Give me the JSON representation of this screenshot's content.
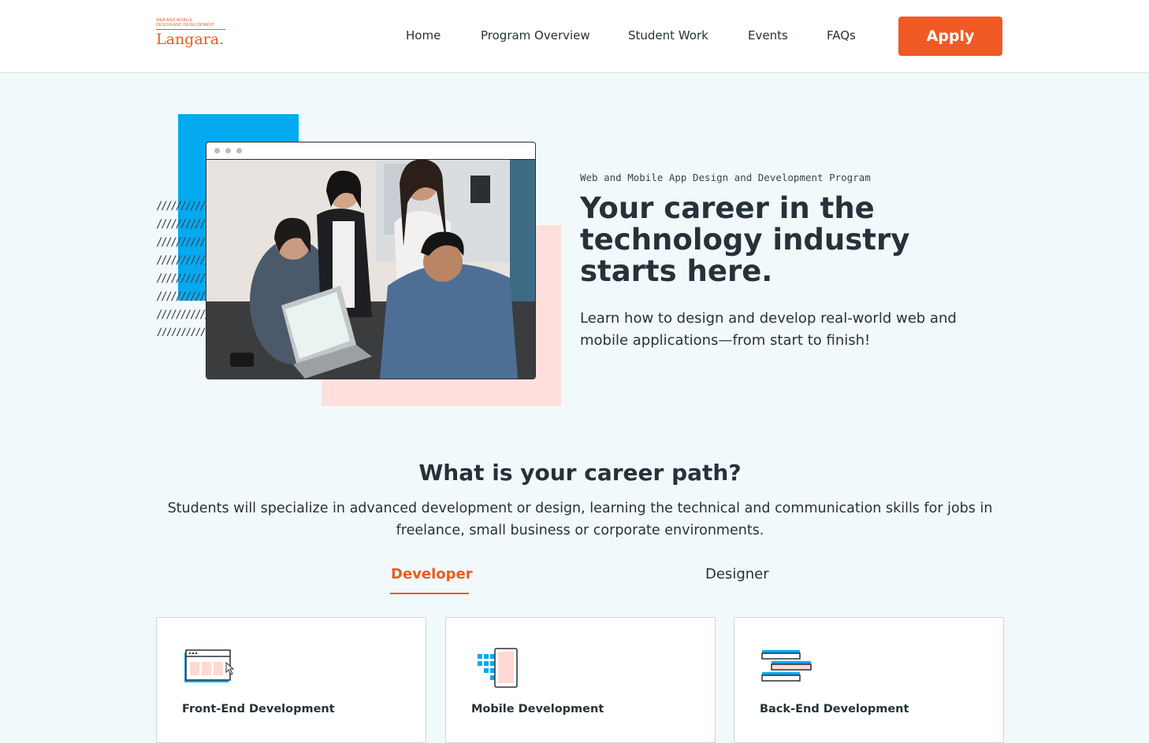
{
  "header": {
    "logo": {
      "tagline": "WEB AND MOBILE\nDESIGN AND DEVELOPMENT",
      "name": "Langara."
    },
    "nav": [
      {
        "label": "Home"
      },
      {
        "label": "Program Overview"
      },
      {
        "label": "Student Work"
      },
      {
        "label": "Events"
      },
      {
        "label": "FAQs"
      }
    ],
    "apply_label": "Apply"
  },
  "hero": {
    "eyebrow": "Web and Mobile App Design and Development Program",
    "title": "Your career in the technology industry starts here.",
    "subtitle": "Learn how to design and develop real-world web and mobile applications—from start to finish!",
    "photo_icon": "students-at-laptop-photo"
  },
  "career": {
    "title": "What is your career path?",
    "description": "Students will specialize in advanced development or design, learning the technical and communication skills for jobs in freelance, small business or corporate environments.",
    "tabs": [
      {
        "label": "Developer",
        "active": true
      },
      {
        "label": "Designer",
        "active": false
      }
    ],
    "cards": [
      {
        "title": "Front-End Development",
        "icon": "browser-window-icon"
      },
      {
        "title": "Mobile Development",
        "icon": "mobile-phone-icon"
      },
      {
        "title": "Back-End Development",
        "icon": "server-stack-icon"
      }
    ]
  },
  "colors": {
    "accent": "#ef5a25",
    "blue": "#05a9f0",
    "pink": "#ffe0dc",
    "background": "#f2f9fb",
    "text": "#26323a"
  }
}
